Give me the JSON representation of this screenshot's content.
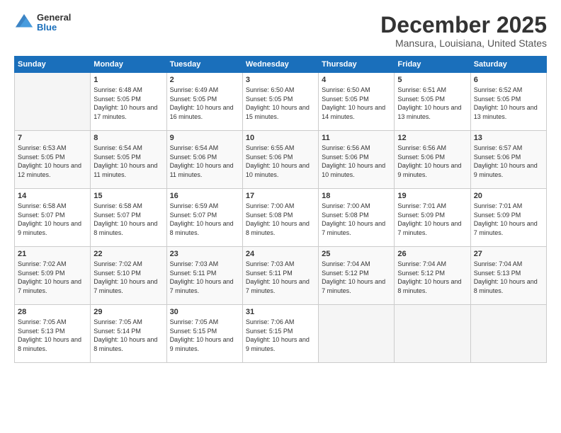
{
  "header": {
    "logo": {
      "general": "General",
      "blue": "Blue"
    },
    "title": "December 2025",
    "location": "Mansura, Louisiana, United States"
  },
  "weekdays": [
    "Sunday",
    "Monday",
    "Tuesday",
    "Wednesday",
    "Thursday",
    "Friday",
    "Saturday"
  ],
  "weeks": [
    [
      {
        "day": "",
        "sunrise": "",
        "sunset": "",
        "daylight": ""
      },
      {
        "day": "1",
        "sunrise": "Sunrise: 6:48 AM",
        "sunset": "Sunset: 5:05 PM",
        "daylight": "Daylight: 10 hours and 17 minutes."
      },
      {
        "day": "2",
        "sunrise": "Sunrise: 6:49 AM",
        "sunset": "Sunset: 5:05 PM",
        "daylight": "Daylight: 10 hours and 16 minutes."
      },
      {
        "day": "3",
        "sunrise": "Sunrise: 6:50 AM",
        "sunset": "Sunset: 5:05 PM",
        "daylight": "Daylight: 10 hours and 15 minutes."
      },
      {
        "day": "4",
        "sunrise": "Sunrise: 6:50 AM",
        "sunset": "Sunset: 5:05 PM",
        "daylight": "Daylight: 10 hours and 14 minutes."
      },
      {
        "day": "5",
        "sunrise": "Sunrise: 6:51 AM",
        "sunset": "Sunset: 5:05 PM",
        "daylight": "Daylight: 10 hours and 13 minutes."
      },
      {
        "day": "6",
        "sunrise": "Sunrise: 6:52 AM",
        "sunset": "Sunset: 5:05 PM",
        "daylight": "Daylight: 10 hours and 13 minutes."
      }
    ],
    [
      {
        "day": "7",
        "sunrise": "Sunrise: 6:53 AM",
        "sunset": "Sunset: 5:05 PM",
        "daylight": "Daylight: 10 hours and 12 minutes."
      },
      {
        "day": "8",
        "sunrise": "Sunrise: 6:54 AM",
        "sunset": "Sunset: 5:05 PM",
        "daylight": "Daylight: 10 hours and 11 minutes."
      },
      {
        "day": "9",
        "sunrise": "Sunrise: 6:54 AM",
        "sunset": "Sunset: 5:06 PM",
        "daylight": "Daylight: 10 hours and 11 minutes."
      },
      {
        "day": "10",
        "sunrise": "Sunrise: 6:55 AM",
        "sunset": "Sunset: 5:06 PM",
        "daylight": "Daylight: 10 hours and 10 minutes."
      },
      {
        "day": "11",
        "sunrise": "Sunrise: 6:56 AM",
        "sunset": "Sunset: 5:06 PM",
        "daylight": "Daylight: 10 hours and 10 minutes."
      },
      {
        "day": "12",
        "sunrise": "Sunrise: 6:56 AM",
        "sunset": "Sunset: 5:06 PM",
        "daylight": "Daylight: 10 hours and 9 minutes."
      },
      {
        "day": "13",
        "sunrise": "Sunrise: 6:57 AM",
        "sunset": "Sunset: 5:06 PM",
        "daylight": "Daylight: 10 hours and 9 minutes."
      }
    ],
    [
      {
        "day": "14",
        "sunrise": "Sunrise: 6:58 AM",
        "sunset": "Sunset: 5:07 PM",
        "daylight": "Daylight: 10 hours and 9 minutes."
      },
      {
        "day": "15",
        "sunrise": "Sunrise: 6:58 AM",
        "sunset": "Sunset: 5:07 PM",
        "daylight": "Daylight: 10 hours and 8 minutes."
      },
      {
        "day": "16",
        "sunrise": "Sunrise: 6:59 AM",
        "sunset": "Sunset: 5:07 PM",
        "daylight": "Daylight: 10 hours and 8 minutes."
      },
      {
        "day": "17",
        "sunrise": "Sunrise: 7:00 AM",
        "sunset": "Sunset: 5:08 PM",
        "daylight": "Daylight: 10 hours and 8 minutes."
      },
      {
        "day": "18",
        "sunrise": "Sunrise: 7:00 AM",
        "sunset": "Sunset: 5:08 PM",
        "daylight": "Daylight: 10 hours and 7 minutes."
      },
      {
        "day": "19",
        "sunrise": "Sunrise: 7:01 AM",
        "sunset": "Sunset: 5:09 PM",
        "daylight": "Daylight: 10 hours and 7 minutes."
      },
      {
        "day": "20",
        "sunrise": "Sunrise: 7:01 AM",
        "sunset": "Sunset: 5:09 PM",
        "daylight": "Daylight: 10 hours and 7 minutes."
      }
    ],
    [
      {
        "day": "21",
        "sunrise": "Sunrise: 7:02 AM",
        "sunset": "Sunset: 5:09 PM",
        "daylight": "Daylight: 10 hours and 7 minutes."
      },
      {
        "day": "22",
        "sunrise": "Sunrise: 7:02 AM",
        "sunset": "Sunset: 5:10 PM",
        "daylight": "Daylight: 10 hours and 7 minutes."
      },
      {
        "day": "23",
        "sunrise": "Sunrise: 7:03 AM",
        "sunset": "Sunset: 5:11 PM",
        "daylight": "Daylight: 10 hours and 7 minutes."
      },
      {
        "day": "24",
        "sunrise": "Sunrise: 7:03 AM",
        "sunset": "Sunset: 5:11 PM",
        "daylight": "Daylight: 10 hours and 7 minutes."
      },
      {
        "day": "25",
        "sunrise": "Sunrise: 7:04 AM",
        "sunset": "Sunset: 5:12 PM",
        "daylight": "Daylight: 10 hours and 7 minutes."
      },
      {
        "day": "26",
        "sunrise": "Sunrise: 7:04 AM",
        "sunset": "Sunset: 5:12 PM",
        "daylight": "Daylight: 10 hours and 8 minutes."
      },
      {
        "day": "27",
        "sunrise": "Sunrise: 7:04 AM",
        "sunset": "Sunset: 5:13 PM",
        "daylight": "Daylight: 10 hours and 8 minutes."
      }
    ],
    [
      {
        "day": "28",
        "sunrise": "Sunrise: 7:05 AM",
        "sunset": "Sunset: 5:13 PM",
        "daylight": "Daylight: 10 hours and 8 minutes."
      },
      {
        "day": "29",
        "sunrise": "Sunrise: 7:05 AM",
        "sunset": "Sunset: 5:14 PM",
        "daylight": "Daylight: 10 hours and 8 minutes."
      },
      {
        "day": "30",
        "sunrise": "Sunrise: 7:05 AM",
        "sunset": "Sunset: 5:15 PM",
        "daylight": "Daylight: 10 hours and 9 minutes."
      },
      {
        "day": "31",
        "sunrise": "Sunrise: 7:06 AM",
        "sunset": "Sunset: 5:15 PM",
        "daylight": "Daylight: 10 hours and 9 minutes."
      },
      {
        "day": "",
        "sunrise": "",
        "sunset": "",
        "daylight": ""
      },
      {
        "day": "",
        "sunrise": "",
        "sunset": "",
        "daylight": ""
      },
      {
        "day": "",
        "sunrise": "",
        "sunset": "",
        "daylight": ""
      }
    ]
  ]
}
